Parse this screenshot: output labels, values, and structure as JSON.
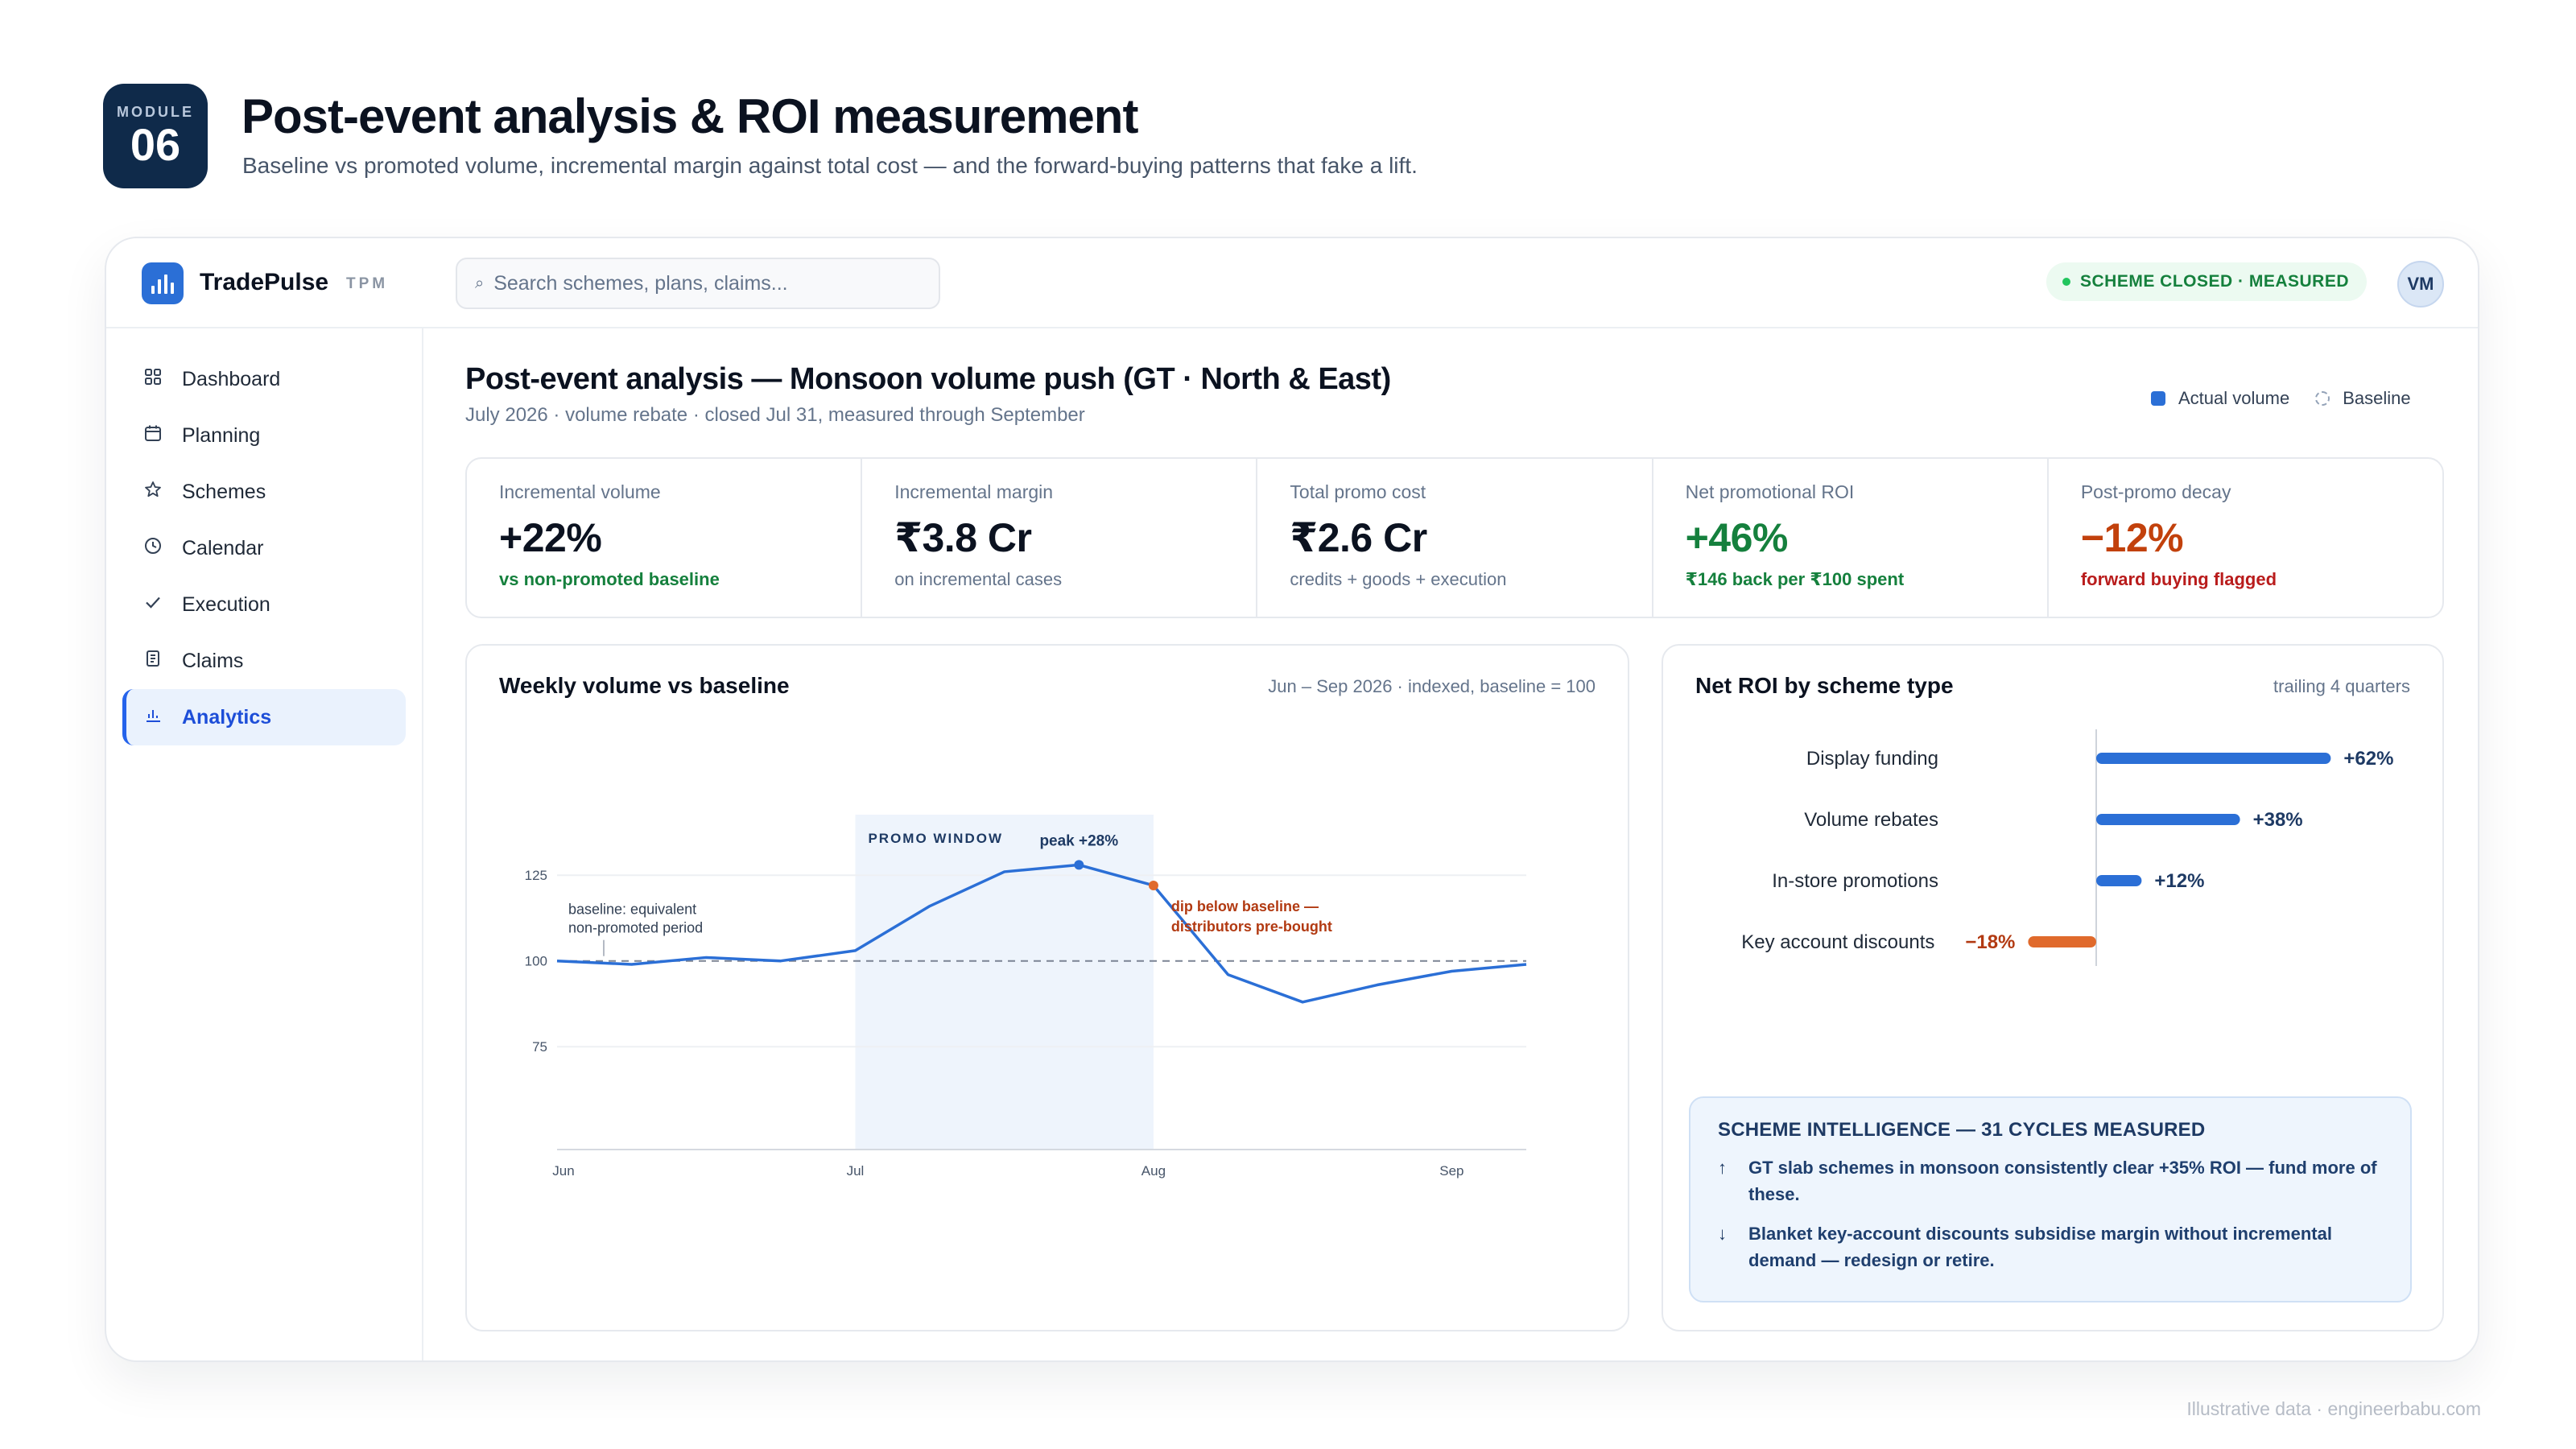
{
  "page": {
    "module_label": "MODULE",
    "module_number": "06",
    "title": "Post-event analysis & ROI measurement",
    "subtitle": "Baseline vs promoted volume, incremental margin against total cost — and the forward-buying patterns that fake a lift.",
    "footer_note": "Illustrative data · engineerbabu.com"
  },
  "topbar": {
    "brand": "TradePulse",
    "brand_tag": "TPM",
    "search_placeholder": "Search schemes, plans, claims...",
    "search_icon": "search-icon",
    "status": "SCHEME CLOSED · MEASURED",
    "avatar_initials": "VM"
  },
  "sidebar": {
    "items": [
      {
        "label": "Dashboard",
        "icon": "grid-icon",
        "active": false
      },
      {
        "label": "Planning",
        "icon": "calendar-icon",
        "active": false
      },
      {
        "label": "Schemes",
        "icon": "star-icon",
        "active": false
      },
      {
        "label": "Calendar",
        "icon": "clock-icon",
        "active": false
      },
      {
        "label": "Execution",
        "icon": "check-icon",
        "active": false
      },
      {
        "label": "Claims",
        "icon": "document-icon",
        "active": false
      },
      {
        "label": "Analytics",
        "icon": "bar-chart-icon",
        "active": true
      }
    ]
  },
  "main": {
    "title": "Post-event analysis — Monsoon volume push (GT · North & East)",
    "subtitle": "July 2026 · volume rebate · closed Jul 31, measured through September",
    "legend": {
      "actual": "Actual volume",
      "baseline": "Baseline"
    }
  },
  "kpis": [
    {
      "label": "Incremental volume",
      "value": "+22%",
      "note": "vs non-promoted baseline",
      "value_tone": "dark",
      "note_tone": "green"
    },
    {
      "label": "Incremental margin",
      "value": "₹3.8 Cr",
      "note": "on incremental cases",
      "value_tone": "dark",
      "note_tone": "muted"
    },
    {
      "label": "Total promo cost",
      "value": "₹2.6 Cr",
      "note": "credits + goods + execution",
      "value_tone": "dark",
      "note_tone": "muted"
    },
    {
      "label": "Net promotional ROI",
      "value": "+46%",
      "note": "₹146 back per ₹100 spent",
      "value_tone": "green",
      "note_tone": "green"
    },
    {
      "label": "Post-promo decay",
      "value": "−12%",
      "note": "forward buying flagged",
      "value_tone": "orange",
      "note_tone": "red"
    }
  ],
  "weekly_panel": {
    "title": "Weekly volume vs baseline",
    "meta": "Jun – Sep 2026 · indexed, baseline = 100",
    "promo_window_label": "PROMO WINDOW",
    "peak_label": "peak +28%",
    "baseline_note_line1": "baseline: equivalent",
    "baseline_note_line2": "non-promoted period",
    "dip_note_line1": "dip below baseline —",
    "dip_note_line2": "distributors pre-bought"
  },
  "roi_panel": {
    "title": "Net ROI by scheme type",
    "meta": "trailing 4 quarters",
    "intel_heading": "SCHEME INTELLIGENCE — 31 CYCLES MEASURED",
    "intel_items": [
      {
        "icon": "arrow-up-icon",
        "text": "GT slab schemes in monsoon consistently clear +35% ROI — fund more of these."
      },
      {
        "icon": "arrow-down-icon",
        "text": "Blanket key-account discounts subsidise margin without incremental demand — redesign or retire."
      }
    ]
  },
  "chart_data": [
    {
      "type": "line",
      "title": "Weekly volume vs baseline",
      "x": [
        "W1",
        "W2",
        "W3",
        "W4",
        "W5",
        "W6",
        "W7",
        "W8",
        "W9",
        "W10",
        "W11",
        "W12",
        "W13",
        "W14"
      ],
      "x_tick_labels": [
        {
          "at": "W1",
          "label": "Jun"
        },
        {
          "at": "W5",
          "label": "Jul"
        },
        {
          "at": "W9",
          "label": "Aug"
        },
        {
          "at": "W13",
          "label": "Sep"
        }
      ],
      "series": [
        {
          "name": "Actual volume",
          "values": [
            100,
            99,
            101,
            100,
            103,
            116,
            126,
            128,
            122,
            96,
            88,
            93,
            97,
            99
          ]
        }
      ],
      "baseline": 100,
      "y_ticks": [
        75,
        100,
        125
      ],
      "ylim": [
        45,
        145
      ],
      "promo_window": [
        "W5",
        "W9"
      ],
      "colors": {
        "line": "#2b6fd6",
        "peak_marker": "#2b6fd6",
        "dip_marker": "#e06a2c",
        "window": "#eef4fc"
      }
    },
    {
      "type": "bar",
      "orientation": "horizontal",
      "title": "Net ROI by scheme type",
      "categories": [
        "Display funding",
        "Volume rebates",
        "In-store promotions",
        "Key account discounts"
      ],
      "values": [
        62,
        38,
        12,
        -18
      ],
      "value_labels": [
        "+62%",
        "+38%",
        "+12%",
        "−18%"
      ],
      "colors": {
        "positive": "#2b6fd6",
        "negative": "#e06a2c"
      }
    }
  ]
}
